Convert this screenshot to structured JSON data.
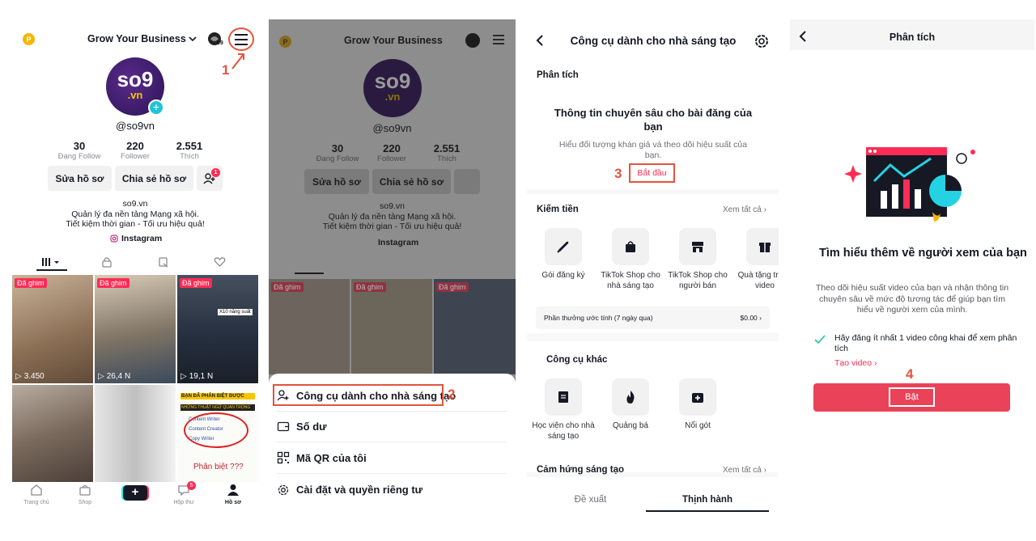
{
  "p1": {
    "account_title": "Grow Your Business",
    "coin_badge": "99",
    "avatar_text": "so9",
    "avatar_sub": ".vn",
    "username": "@so9vn",
    "stats": [
      {
        "value": "30",
        "label": "Đang Follow"
      },
      {
        "value": "220",
        "label": "Follower"
      },
      {
        "value": "2.551",
        "label": "Thích"
      }
    ],
    "edit_btn": "Sửa hồ sơ",
    "share_btn": "Chia sẻ hồ sơ",
    "add_friend_badge": "1",
    "bio_name": "so9.vn",
    "bio_line1": "Quản lý đa nền tảng Mạng xã hội.",
    "bio_line2": "Tiết kiệm thời gian - Tối ưu hiệu quả!",
    "instagram": "Instagram",
    "pinned": "Đã ghim",
    "views": [
      "3.450",
      "26,4 N",
      "19,1 N"
    ],
    "thumb_texts": [
      "BẠN ĐÃ PHÂN BIỆT ĐƯỢC",
      "NHỮNG THUẬT NGỮ QUAN TRỌNG",
      "Content Writer",
      "Content Creator",
      "Copy Writer",
      "Phân biệt ???",
      "X10 năng suất"
    ],
    "nav": [
      "Trang chủ",
      "Shop",
      "Hộp thư",
      "Hồ sơ"
    ],
    "inbox_badge": "5",
    "step": "1"
  },
  "p2": {
    "menu": [
      "Công cụ dành cho nhà sáng tạo",
      "Số dư",
      "Mã QR của tôi",
      "Cài đặt và quyền riêng tư"
    ],
    "step": "2"
  },
  "p3": {
    "title": "Công cụ dành cho nhà sáng tạo",
    "section_analytics": "Phân tích",
    "insight_title": "Thông tin chuyên sâu cho bài đăng của bạn",
    "insight_desc": "Hiểu đối tượng khán giả và theo dõi hiệu suất của bạn.",
    "start_btn": "Bắt đầu",
    "step": "3",
    "section_monetize": "Kiếm tiền",
    "see_all": "Xem tất cả",
    "monetize_tools": [
      "Gói đăng ký",
      "TikTok Shop cho nhà sáng tạo",
      "TikTok Shop cho người bán",
      "Quà tặng trong video"
    ],
    "reward_label": "Phần thưởng ước tính (7 ngày qua)",
    "reward_value": "$0.00",
    "section_other": "Công cụ khác",
    "other_tools": [
      "Học viện cho nhà sáng tạo",
      "Quảng bá",
      "Nổi gót"
    ],
    "section_inspire": "Cảm hứng sáng tạo",
    "tabs": [
      "Đề xuất",
      "Thịnh hành"
    ]
  },
  "p4": {
    "title": "Phân tích",
    "heading": "Tìm hiểu thêm về người xem của bạn",
    "desc": "Theo dõi hiệu suất video của bạn và nhận thông tin chuyên sâu về mức độ tương tác để giúp bạn tìm hiểu về người xem của mình.",
    "check_text": "Hãy đăng ít nhất 1 video công khai để xem phân tích",
    "create_link": "Tạo video",
    "on_btn": "Bật",
    "step": "4"
  },
  "colors": {
    "brand": "#fe2c55",
    "annotation": "#e5533c",
    "button": "#ea4359"
  }
}
